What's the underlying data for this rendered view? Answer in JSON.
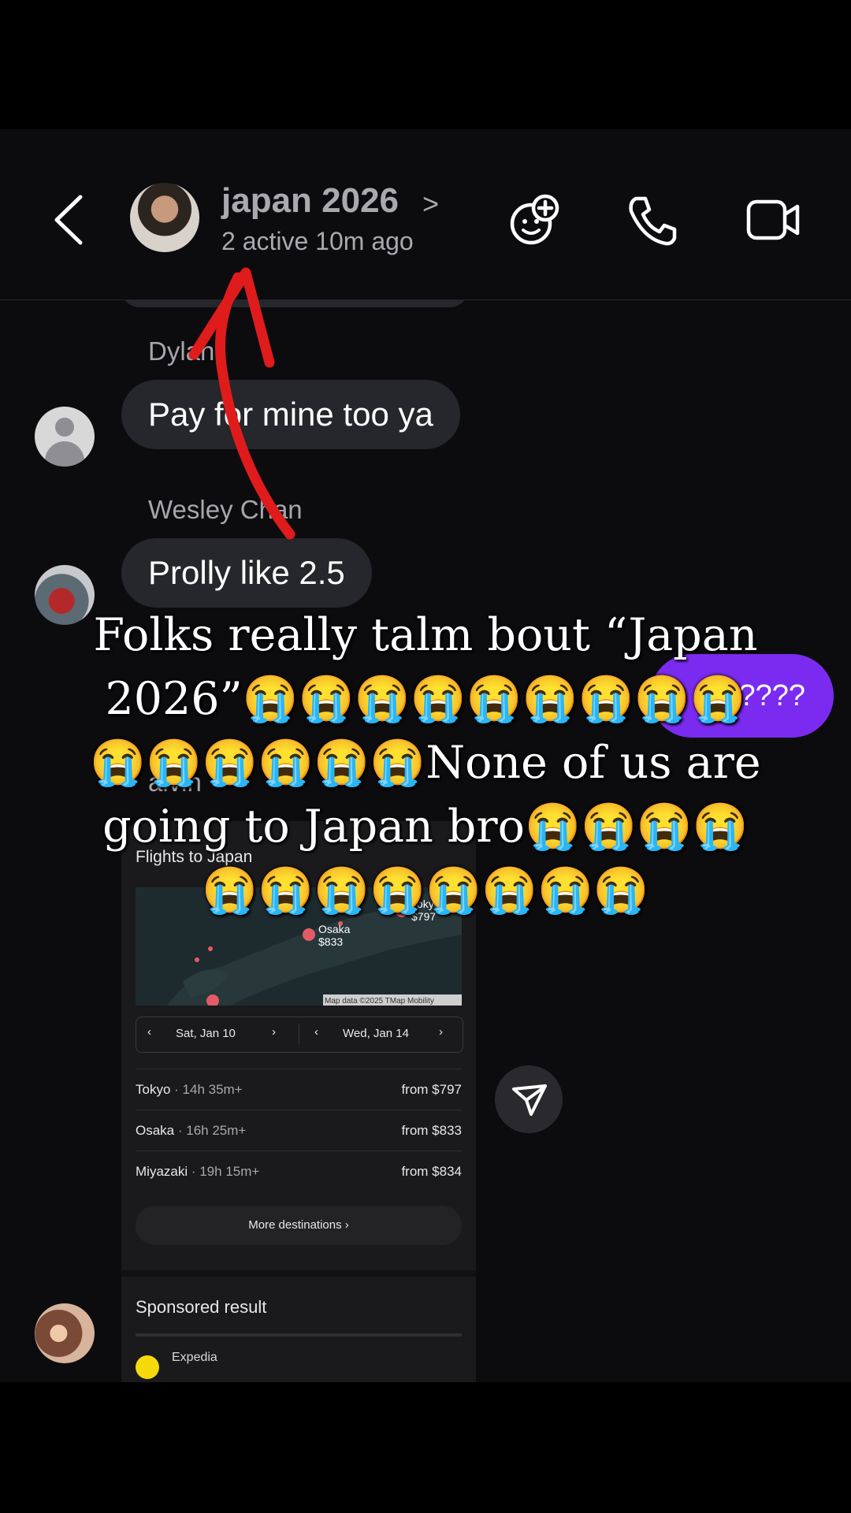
{
  "header": {
    "title": "japan 2026",
    "title_chevron": ">",
    "subtitle": "2 active 10m ago",
    "icons": [
      "back-chevron-icon",
      "add-people-icon",
      "phone-icon",
      "video-camera-icon"
    ]
  },
  "messages": [
    {
      "sender": "Dylan",
      "text": "Pay for mine too ya"
    },
    {
      "sender": "Wesley Chan",
      "text": "Prolly like 2.5"
    },
    {
      "sender": "me",
      "text": "k????"
    },
    {
      "sender": "alvin",
      "text": ""
    }
  ],
  "flight_card": {
    "title": "Flights to Japan",
    "map": {
      "labels": [
        {
          "city": "Tokyo",
          "price": "$797"
        },
        {
          "city": "Osaka",
          "price": "$833"
        }
      ],
      "attribution": "Map data ©2025 TMap Mobility"
    },
    "depart_date": "Sat, Jan 10",
    "return_date": "Wed, Jan 14",
    "rows": [
      {
        "city": "Tokyo",
        "duration": " · 14h 35m+",
        "price": "from $797"
      },
      {
        "city": "Osaka",
        "duration": " · 16h 25m+",
        "price": "from $833"
      },
      {
        "city": "Miyazaki",
        "duration": " · 19h 15m+",
        "price": "from $834"
      }
    ],
    "more_label": "More destinations",
    "sponsored_label": "Sponsored result",
    "sponsor_name": "Expedia"
  },
  "overlay": {
    "caption": "Folks really talm bout “Japan 2026”😭😭😭😭😭😭😭😭😭😭😭😭😭😭😭None of us are going to Japan bro😭😭😭😭😭😭😭😭😭😭😭😭"
  },
  "colors": {
    "background": "#0c0c0f",
    "bubble": "#26272c",
    "sent_bubble": "#7b2bf0",
    "annotation_arrow": "#e01b1b"
  }
}
